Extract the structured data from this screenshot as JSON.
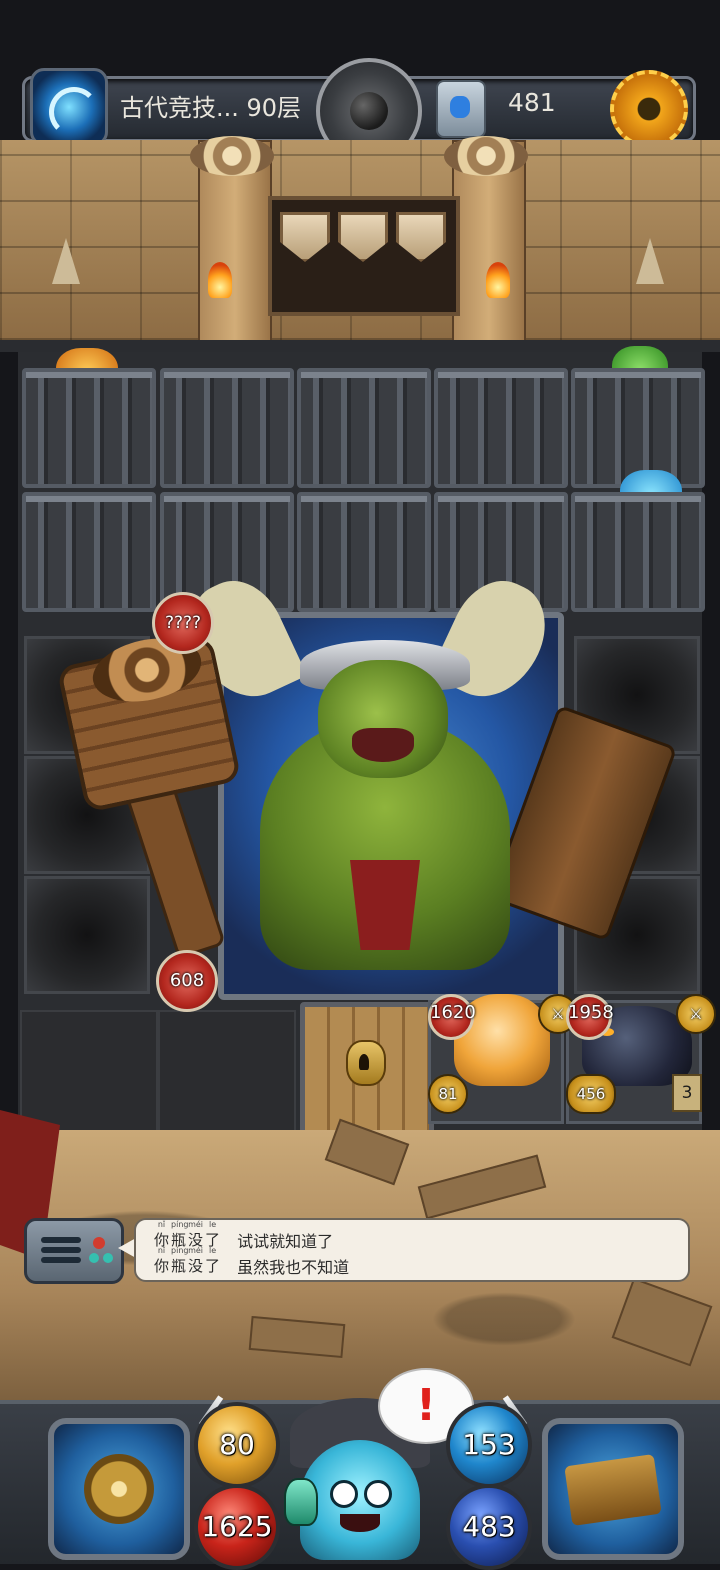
{
  "top_bar": {
    "floor_label": "古代竞技... 90层",
    "rune_count": "481"
  },
  "board": {
    "boss": {
      "attack_label": "????",
      "hp": "608"
    },
    "pets": [
      {
        "name": "cat",
        "hp": "1620",
        "attack": "81"
      },
      {
        "name": "panther",
        "hp": "1958",
        "attack": "456",
        "scroll_count": "3"
      }
    ]
  },
  "dialog": {
    "lines": [
      {
        "speaker": [
          "你",
          "瓶",
          "没",
          "了"
        ],
        "pinyin": [
          "nǐ",
          "píng",
          "méi",
          "le"
        ],
        "message": "试试就知道了"
      },
      {
        "speaker": [
          "你",
          "瓶",
          "没",
          "了"
        ],
        "pinyin": [
          "nǐ",
          "píng",
          "méi",
          "le"
        ],
        "message": "虽然我也不知道"
      }
    ]
  },
  "hud": {
    "attack": "80",
    "hp": "1625",
    "defense": "153",
    "mana": "483",
    "alert": "!"
  },
  "icons": {
    "portal": "portal-icon",
    "bomb": "bomb-icon",
    "rune": "rune-icon",
    "settings": "gear-icon",
    "chat": "chat-log-icon",
    "compass": "compass-icon",
    "spellbook": "spellbook-icon"
  },
  "colors": {
    "attack_badge": "#b3271e",
    "gold_badge": "#c7901c",
    "alert": "#e0211c",
    "panel": "#2b2d31"
  }
}
